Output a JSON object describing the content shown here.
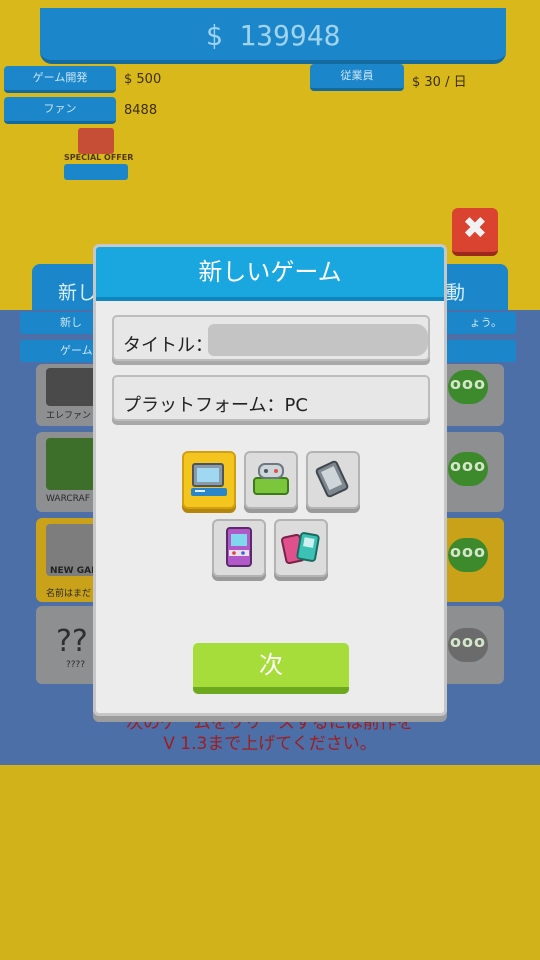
{
  "hud": {
    "money": "$ 139948",
    "btn1": "ゲーム開発",
    "btn1_value": "$ 500",
    "btn2": "ファン",
    "btn2_value": "8488",
    "btn3": "従業員",
    "btn3_value": "$ 30 / 日",
    "gift_label": "SPECIAL OFFER"
  },
  "background": {
    "tab_left": "新し",
    "tab_right": "動",
    "sub_left_1": "新し",
    "sub_right_1": "ょう。",
    "sub_left_2": "ゲーム",
    "cards": [
      {
        "label": "エレファント"
      },
      {
        "label": "WARCRAF"
      },
      {
        "label": "名前はまだ",
        "badge": "NEW GAM"
      },
      {
        "label": "????",
        "mark": "??"
      }
    ],
    "message_line1": "次のゲームをリリースするには前作を",
    "message_line2": "V 1.3まで上げてください。"
  },
  "dialog": {
    "title": "新しいゲーム",
    "title_label": "タイトル：",
    "title_value": "",
    "platform_label": "プラットフォーム：PC",
    "platforms": [
      {
        "name": "PC",
        "selected": true
      },
      {
        "name": "Console",
        "selected": false
      },
      {
        "name": "Mobile",
        "selected": false
      },
      {
        "name": "Arcade",
        "selected": false
      },
      {
        "name": "Handheld",
        "selected": false
      }
    ],
    "next_button": "次"
  },
  "colors": {
    "header": "#1aa6df",
    "selected": "#f3c51e",
    "next": "#a6dd3a",
    "close": "#d9432f"
  }
}
